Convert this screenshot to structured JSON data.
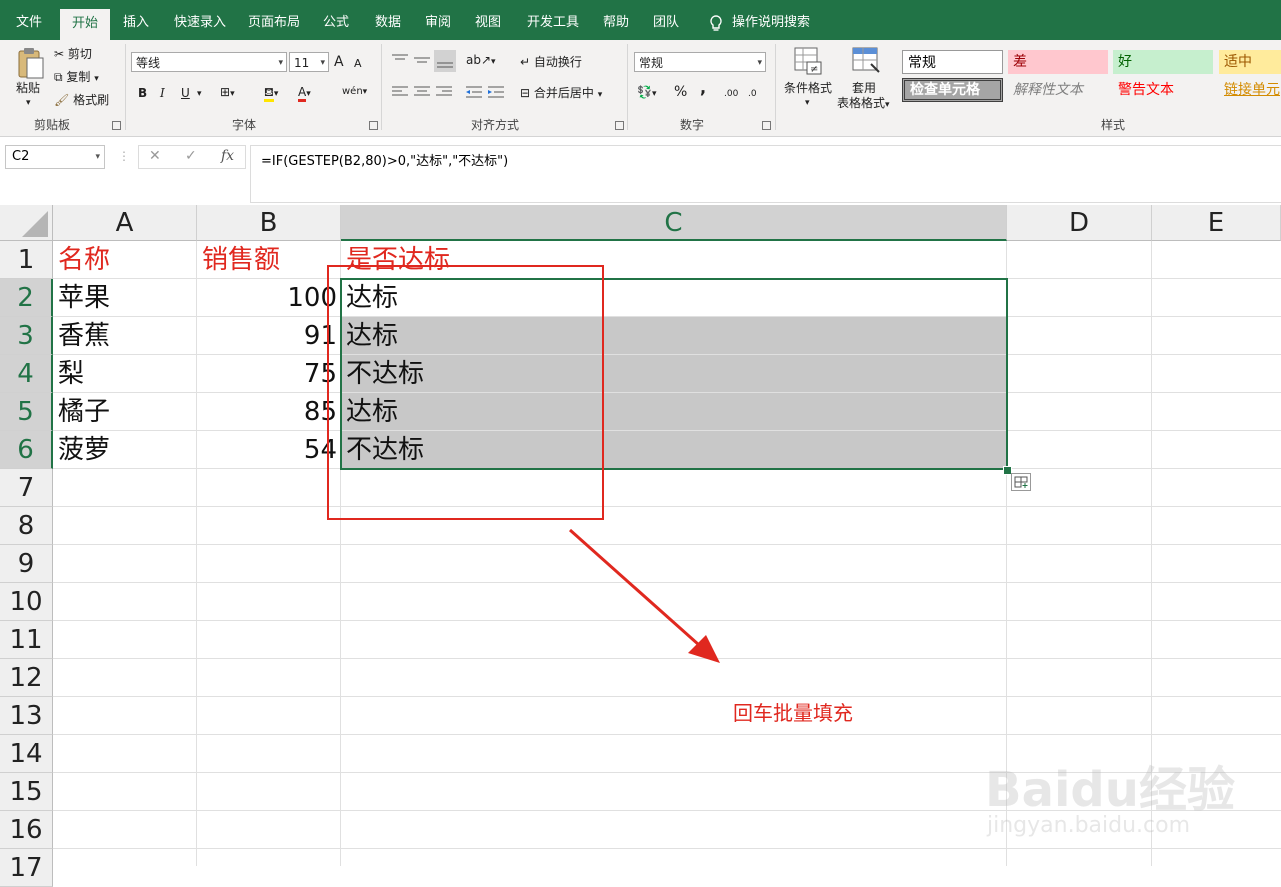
{
  "ribbon_tabs": [
    "文件",
    "开始",
    "插入",
    "快速录入",
    "页面布局",
    "公式",
    "数据",
    "审阅",
    "视图",
    "开发工具",
    "帮助",
    "团队",
    "操作说明搜索"
  ],
  "clipboard": {
    "paste": "粘贴",
    "cut": "剪切",
    "copy": "复制",
    "format_painter": "格式刷",
    "group": "剪贴板"
  },
  "font": {
    "name": "等线",
    "size": "11",
    "group": "字体",
    "grow": "A",
    "shrink": "A",
    "bold": "B",
    "italic": "I",
    "underline": "U",
    "color_letter": "A",
    "wen": "wén"
  },
  "alignment": {
    "wrap": "自动换行",
    "merge": "合并后居中",
    "group": "对齐方式"
  },
  "number": {
    "format": "常规",
    "percent": "%",
    "comma": ",",
    "inc": ".00",
    "dec": ".0",
    "group": "数字"
  },
  "styles_group": {
    "conditional": "条件格式",
    "table1": "套用",
    "table2": "表格格式",
    "group": "样式"
  },
  "styles": {
    "normal": "常规",
    "bad": "差",
    "good": "好",
    "neutral": "适中",
    "check": "检查单元格",
    "explanatory": "解释性文本",
    "warning": "警告文本",
    "link": "链接单元"
  },
  "formula_bar": {
    "name_box": "C2",
    "formula": "=IF(GESTEP(B2,80)>0,\"达标\",\"不达标\")",
    "fx": "fx"
  },
  "columns": [
    "A",
    "B",
    "C",
    "D",
    "E"
  ],
  "rows": [
    "1",
    "2",
    "3",
    "4",
    "5",
    "6",
    "7",
    "8",
    "9",
    "10",
    "11",
    "12",
    "13",
    "14",
    "15",
    "16",
    "17"
  ],
  "headers": {
    "a": "名称",
    "b": "销售额",
    "c": "是否达标"
  },
  "table": [
    {
      "name": "苹果",
      "sales": "100",
      "status": "达标"
    },
    {
      "name": "香蕉",
      "sales": "91",
      "status": "达标"
    },
    {
      "name": "梨",
      "sales": "75",
      "status": "不达标"
    },
    {
      "name": "橘子",
      "sales": "85",
      "status": "达标"
    },
    {
      "name": "菠萝",
      "sales": "54",
      "status": "不达标"
    }
  ],
  "annotation": "回车批量填充",
  "watermark": {
    "logo": "Baidu经验",
    "url": "jingyan.baidu.com"
  },
  "colors": {
    "excel_green": "#217346",
    "annotation_red": "#e0281f",
    "selection_gray": "#c8c8c8"
  }
}
